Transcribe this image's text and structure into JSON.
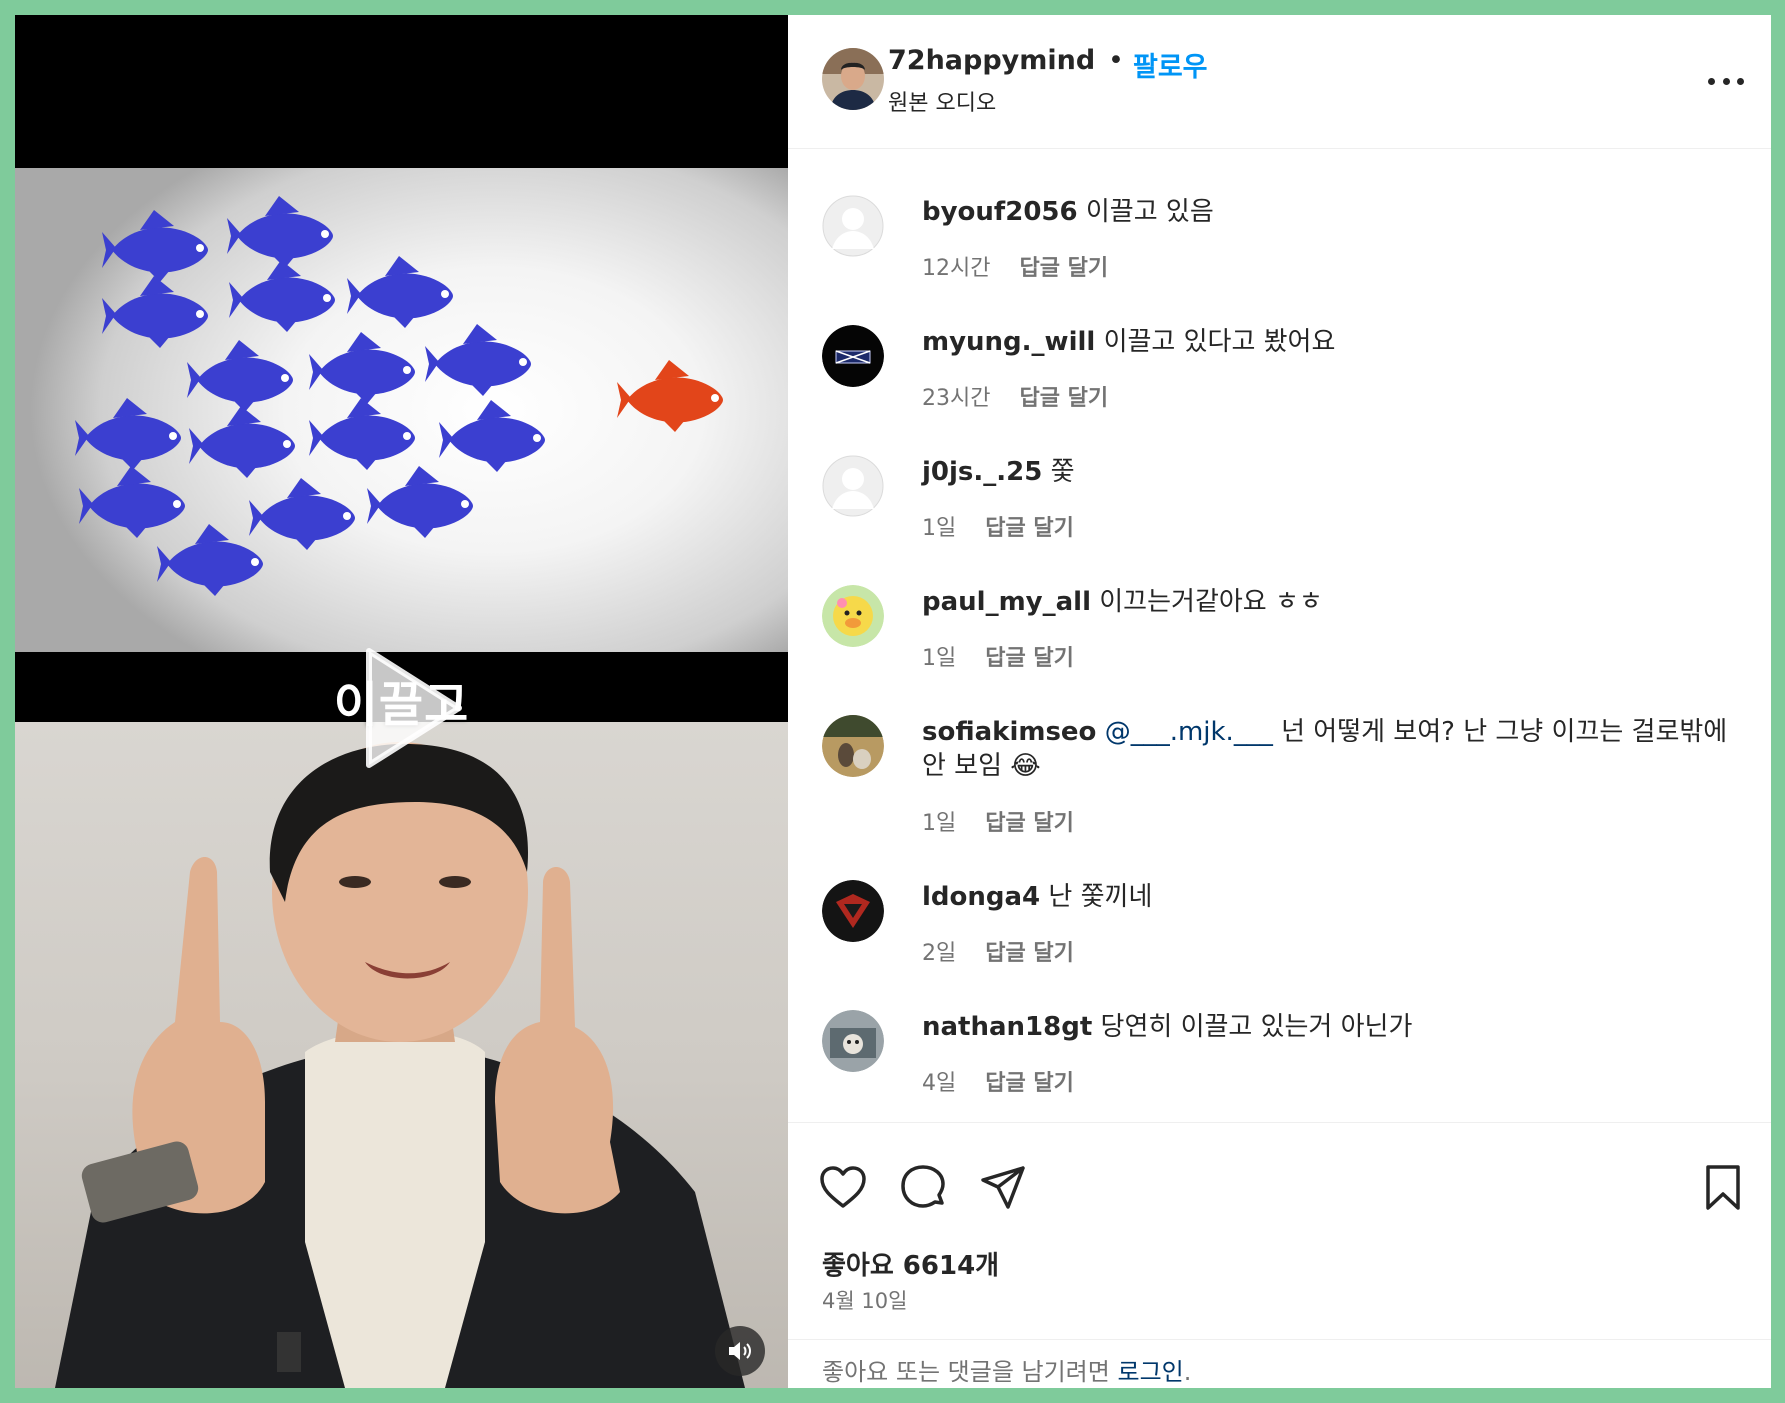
{
  "video": {
    "caption": "이끌고"
  },
  "header": {
    "username": "72happymind",
    "separator": "•",
    "follow_label": "팔로우",
    "subtitle": "원본 오디오"
  },
  "comments": [
    {
      "user": "byouf2056",
      "text": "이끌고 있음",
      "time": "12시간",
      "reply": "답글 달기"
    },
    {
      "user": "myung._will",
      "text": "이끌고 있다고 봤어요",
      "time": "23시간",
      "reply": "답글 달기"
    },
    {
      "user": "j0js._.25",
      "text": "쫓",
      "time": "1일",
      "reply": "답글 달기"
    },
    {
      "user": "paul_my_all",
      "text": "이끄는거같아요 ㅎㅎ",
      "time": "1일",
      "reply": "답글 달기"
    },
    {
      "user": "sofiakimseo",
      "mention": "@___.mjk.___",
      "text": "넌 어떻게 보여? 난 그냥 이끄는 걸로밖에 안 보임 😂",
      "time": "1일",
      "reply": "답글 달기"
    },
    {
      "user": "ldonga4",
      "text": "난 쫓끼네",
      "time": "2일",
      "reply": "답글 달기"
    },
    {
      "user": "nathan18gt",
      "text": "당연히 이끌고 있는거 아닌가",
      "time": "4일",
      "reply": "답글 달기"
    }
  ],
  "actions": {
    "likes": "좋아요 6614개",
    "date": "4월 10일",
    "login_prompt": "좋아요 또는 댓글을 남기려면",
    "login_link": "로그인",
    "login_suffix": "."
  },
  "icons": {
    "like": "heart-icon",
    "comment": "comment-icon",
    "share": "send-icon",
    "save": "bookmark-icon",
    "more": "more-horizontal-icon",
    "play": "play-icon",
    "sound": "speaker-icon"
  },
  "colors": {
    "follow": "#0095f6",
    "mention": "#00376b",
    "school_fish": "#3b3fd0",
    "leader_fish": "#e2451a",
    "frame_border": "#7fcb9b"
  }
}
